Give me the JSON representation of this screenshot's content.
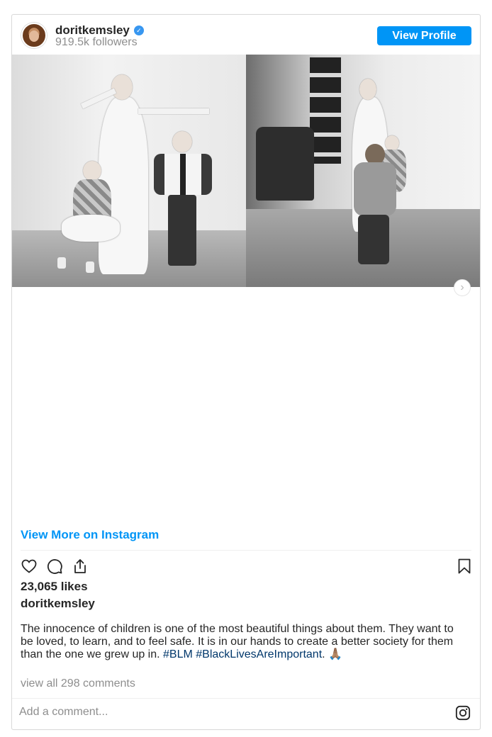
{
  "header": {
    "username": "doritkemsley",
    "verified_icon": "verified-badge-icon",
    "followers": "919.5k followers",
    "view_profile_label": "View Profile"
  },
  "media": {
    "carousel_next_icon": "chevron-right-icon",
    "carousel_next_glyph": "›"
  },
  "view_more_label": "View More on Instagram",
  "actions": {
    "like_icon": "heart-icon",
    "comment_icon": "comment-icon",
    "share_icon": "share-icon",
    "save_icon": "bookmark-icon"
  },
  "likes": "23,065 likes",
  "author": "doritkemsley",
  "caption": {
    "text": "The innocence of children is one of the most beautiful things about them. They want to be loved, to learn, and to feel safe. It is in our hands to create a better society for them than the one we grew up in. ",
    "hashtag1": "#BLM",
    "hashtag2": "#BlackLivesAreImportant",
    "ending": ". 🙏🏽"
  },
  "comments_link": "view all 298 comments",
  "comment_placeholder": "Add a comment...",
  "instagram_icon": "instagram-icon",
  "colors": {
    "accent": "#0095f6",
    "hashtag": "#00376b",
    "muted": "#8e8e8e",
    "border": "#dbdbdb"
  }
}
